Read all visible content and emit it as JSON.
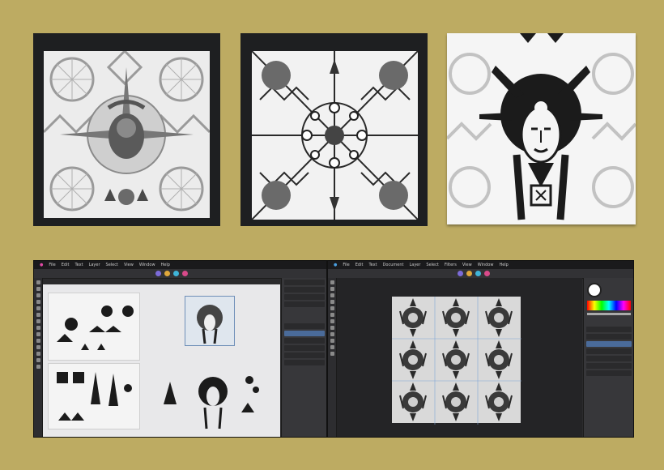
{
  "colors": {
    "background": "#bdab62",
    "frame": "#1e1f21",
    "ink": "#1b1b1b",
    "pattern_gray": "#8d8d8d",
    "app_dark": "#2b2b2d",
    "selection_blue": "#4a6b9a"
  },
  "left_app": {
    "menu": [
      "File",
      "Edit",
      "Text",
      "Layer",
      "Select",
      "View",
      "Window",
      "Help"
    ]
  },
  "right_app": {
    "menu": [
      "File",
      "Edit",
      "Text",
      "Document",
      "Layer",
      "Select",
      "Filters",
      "View",
      "Window",
      "Help"
    ]
  },
  "icons": [
    "sun-mask-icon",
    "kaleidoscope-icon",
    "mask-figure-icon"
  ]
}
